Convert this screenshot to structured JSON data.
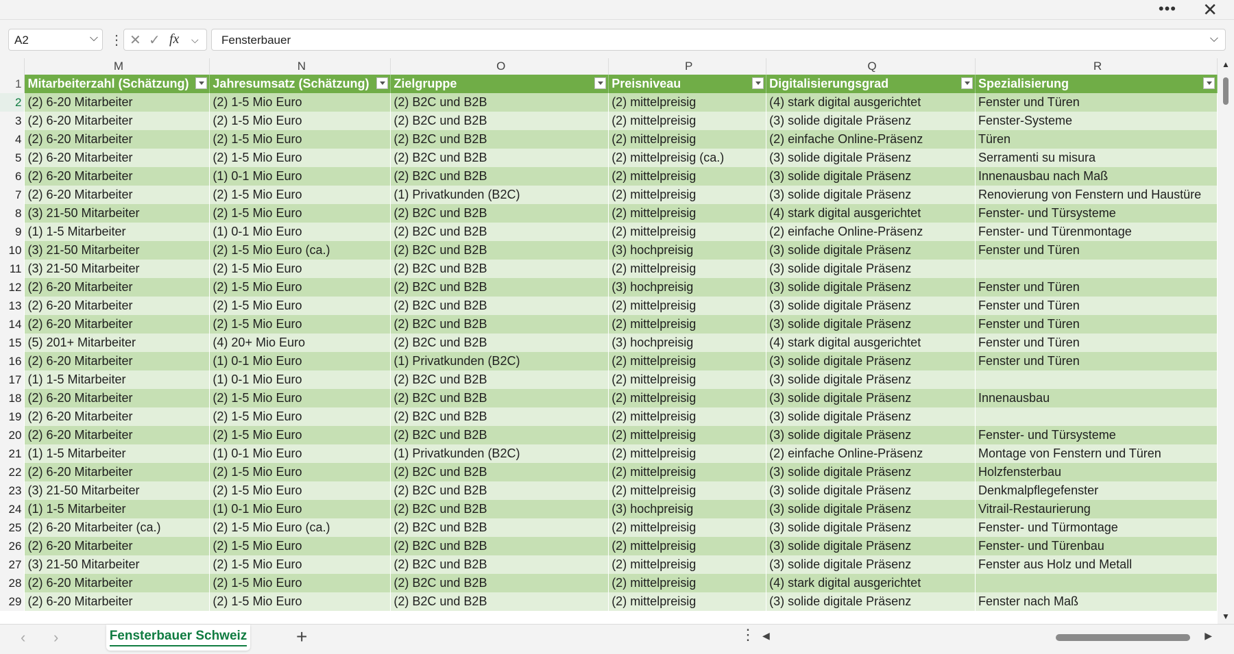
{
  "window": {
    "more_icon": "more-horizontal-icon",
    "close_icon": "close-icon"
  },
  "formula_bar": {
    "name_box": "A2",
    "formula": "Fensterbauer",
    "fx_label": "fx"
  },
  "columns": [
    "M",
    "N",
    "O",
    "P",
    "Q",
    "R"
  ],
  "header_row_number": "1",
  "headers": [
    "Mitarbeiterzahl (Schätzung)",
    "Jahresumsatz (Schätzung)",
    "Zielgruppe",
    "Preisniveau",
    "Digitalisierungsgrad",
    "Spezialisierung"
  ],
  "rows": [
    {
      "n": "2",
      "c": [
        "(2) 6-20 Mitarbeiter",
        "(2) 1-5 Mio Euro",
        "(2) B2C und B2B",
        "(2) mittelpreisig",
        "(4) stark digital ausgerichtet",
        "Fenster und Türen"
      ]
    },
    {
      "n": "3",
      "c": [
        "(2) 6-20 Mitarbeiter",
        "(2) 1-5 Mio Euro",
        "(2) B2C und B2B",
        "(2) mittelpreisig",
        "(3) solide digitale Präsenz",
        "Fenster-Systeme"
      ]
    },
    {
      "n": "4",
      "c": [
        "(2) 6-20 Mitarbeiter",
        "(2) 1-5 Mio Euro",
        "(2) B2C und B2B",
        "(2) mittelpreisig",
        "(2) einfache Online-Präsenz",
        "Türen"
      ]
    },
    {
      "n": "5",
      "c": [
        "(2) 6-20 Mitarbeiter",
        "(2) 1-5 Mio Euro",
        "(2) B2C und B2B",
        "(2) mittelpreisig (ca.)",
        "(3) solide digitale Präsenz",
        "Serramenti su misura"
      ]
    },
    {
      "n": "6",
      "c": [
        "(2) 6-20 Mitarbeiter",
        "(1) 0-1 Mio Euro",
        "(2) B2C und B2B",
        "(2) mittelpreisig",
        "(3) solide digitale Präsenz",
        "Innenausbau nach Maß"
      ]
    },
    {
      "n": "7",
      "c": [
        "(2) 6-20 Mitarbeiter",
        "(2) 1-5 Mio Euro",
        "(1) Privatkunden (B2C)",
        "(2) mittelpreisig",
        "(3) solide digitale Präsenz",
        "Renovierung von Fenstern und Haustüre"
      ]
    },
    {
      "n": "8",
      "c": [
        "(3) 21-50 Mitarbeiter",
        "(2) 1-5 Mio Euro",
        "(2) B2C und B2B",
        "(2) mittelpreisig",
        "(4) stark digital ausgerichtet",
        "Fenster- und Türsysteme"
      ]
    },
    {
      "n": "9",
      "c": [
        "(1) 1-5 Mitarbeiter",
        "(1) 0-1 Mio Euro",
        "(2) B2C und B2B",
        "(2) mittelpreisig",
        "(2) einfache Online-Präsenz",
        "Fenster- und Türenmontage"
      ]
    },
    {
      "n": "10",
      "c": [
        "(3) 21-50 Mitarbeiter",
        "(2) 1-5 Mio Euro (ca.)",
        "(2) B2C und B2B",
        "(3) hochpreisig",
        "(3) solide digitale Präsenz",
        "Fenster und Türen"
      ]
    },
    {
      "n": "11",
      "c": [
        "(3) 21-50 Mitarbeiter",
        "(2) 1-5 Mio Euro",
        "(2) B2C und B2B",
        "(2) mittelpreisig",
        "(3) solide digitale Präsenz",
        ""
      ]
    },
    {
      "n": "12",
      "c": [
        "(2) 6-20 Mitarbeiter",
        "(2) 1-5 Mio Euro",
        "(2) B2C und B2B",
        "(3) hochpreisig",
        "(3) solide digitale Präsenz",
        "Fenster und Türen"
      ]
    },
    {
      "n": "13",
      "c": [
        "(2) 6-20 Mitarbeiter",
        "(2) 1-5 Mio Euro",
        "(2) B2C und B2B",
        "(2) mittelpreisig",
        "(3) solide digitale Präsenz",
        "Fenster und Türen"
      ]
    },
    {
      "n": "14",
      "c": [
        "(2) 6-20 Mitarbeiter",
        "(2) 1-5 Mio Euro",
        "(2) B2C und B2B",
        "(2) mittelpreisig",
        "(3) solide digitale Präsenz",
        "Fenster und Türen"
      ]
    },
    {
      "n": "15",
      "c": [
        "(5) 201+ Mitarbeiter",
        "(4) 20+ Mio Euro",
        "(2) B2C und B2B",
        "(3) hochpreisig",
        "(4) stark digital ausgerichtet",
        "Fenster und Türen"
      ]
    },
    {
      "n": "16",
      "c": [
        "(2) 6-20 Mitarbeiter",
        "(1) 0-1 Mio Euro",
        "(1) Privatkunden (B2C)",
        "(2) mittelpreisig",
        "(3) solide digitale Präsenz",
        "Fenster und Türen"
      ]
    },
    {
      "n": "17",
      "c": [
        "(1) 1-5 Mitarbeiter",
        "(1) 0-1 Mio Euro",
        "(2) B2C und B2B",
        "(2) mittelpreisig",
        "(3) solide digitale Präsenz",
        ""
      ]
    },
    {
      "n": "18",
      "c": [
        "(2) 6-20 Mitarbeiter",
        "(2) 1-5 Mio Euro",
        "(2) B2C und B2B",
        "(2) mittelpreisig",
        "(3) solide digitale Präsenz",
        "Innenausbau"
      ]
    },
    {
      "n": "19",
      "c": [
        "(2) 6-20 Mitarbeiter",
        "(2) 1-5 Mio Euro",
        "(2) B2C und B2B",
        "(2) mittelpreisig",
        "(3) solide digitale Präsenz",
        ""
      ]
    },
    {
      "n": "20",
      "c": [
        "(2) 6-20 Mitarbeiter",
        "(2) 1-5 Mio Euro",
        "(2) B2C und B2B",
        "(2) mittelpreisig",
        "(3) solide digitale Präsenz",
        "Fenster- und Türsysteme"
      ]
    },
    {
      "n": "21",
      "c": [
        "(1) 1-5 Mitarbeiter",
        "(1) 0-1 Mio Euro",
        "(1) Privatkunden (B2C)",
        "(2) mittelpreisig",
        "(2) einfache Online-Präsenz",
        "Montage von Fenstern und Türen"
      ]
    },
    {
      "n": "22",
      "c": [
        "(2) 6-20 Mitarbeiter",
        "(2) 1-5 Mio Euro",
        "(2) B2C und B2B",
        "(2) mittelpreisig",
        "(3) solide digitale Präsenz",
        "Holzfensterbau"
      ]
    },
    {
      "n": "23",
      "c": [
        "(3) 21-50 Mitarbeiter",
        "(2) 1-5 Mio Euro",
        "(2) B2C und B2B",
        "(2) mittelpreisig",
        "(3) solide digitale Präsenz",
        "Denkmalpflegefenster"
      ]
    },
    {
      "n": "24",
      "c": [
        "(1) 1-5 Mitarbeiter",
        "(1) 0-1 Mio Euro",
        "(2) B2C und B2B",
        "(3) hochpreisig",
        "(3) solide digitale Präsenz",
        "Vitrail-Restaurierung"
      ]
    },
    {
      "n": "25",
      "c": [
        "(2) 6-20 Mitarbeiter (ca.)",
        "(2) 1-5 Mio Euro (ca.)",
        "(2) B2C und B2B",
        "(2) mittelpreisig",
        "(3) solide digitale Präsenz",
        "Fenster- und Türmontage"
      ]
    },
    {
      "n": "26",
      "c": [
        "(2) 6-20 Mitarbeiter",
        "(2) 1-5 Mio Euro",
        "(2) B2C und B2B",
        "(2) mittelpreisig",
        "(3) solide digitale Präsenz",
        "Fenster- und Türenbau"
      ]
    },
    {
      "n": "27",
      "c": [
        "(3) 21-50 Mitarbeiter",
        "(2) 1-5 Mio Euro",
        "(2) B2C und B2B",
        "(2) mittelpreisig",
        "(3) solide digitale Präsenz",
        "Fenster aus Holz und Metall"
      ]
    },
    {
      "n": "28",
      "c": [
        "(2) 6-20 Mitarbeiter",
        "(2) 1-5 Mio Euro",
        "(2) B2C und B2B",
        "(2) mittelpreisig",
        "(4) stark digital ausgerichtet",
        ""
      ]
    },
    {
      "n": "29",
      "c": [
        "(2) 6-20 Mitarbeiter",
        "(2) 1-5 Mio Euro",
        "(2) B2C und B2B",
        "(2) mittelpreisig",
        "(3) solide digitale Präsenz",
        "Fenster nach Maß"
      ]
    }
  ],
  "sheet_tabs": {
    "active": "Fensterbauer Schweiz",
    "add_label": "+"
  },
  "colors": {
    "header_green": "#70ad47",
    "band_dark": "#c6e0b4",
    "band_light": "#e2efda",
    "accent": "#107c41"
  }
}
